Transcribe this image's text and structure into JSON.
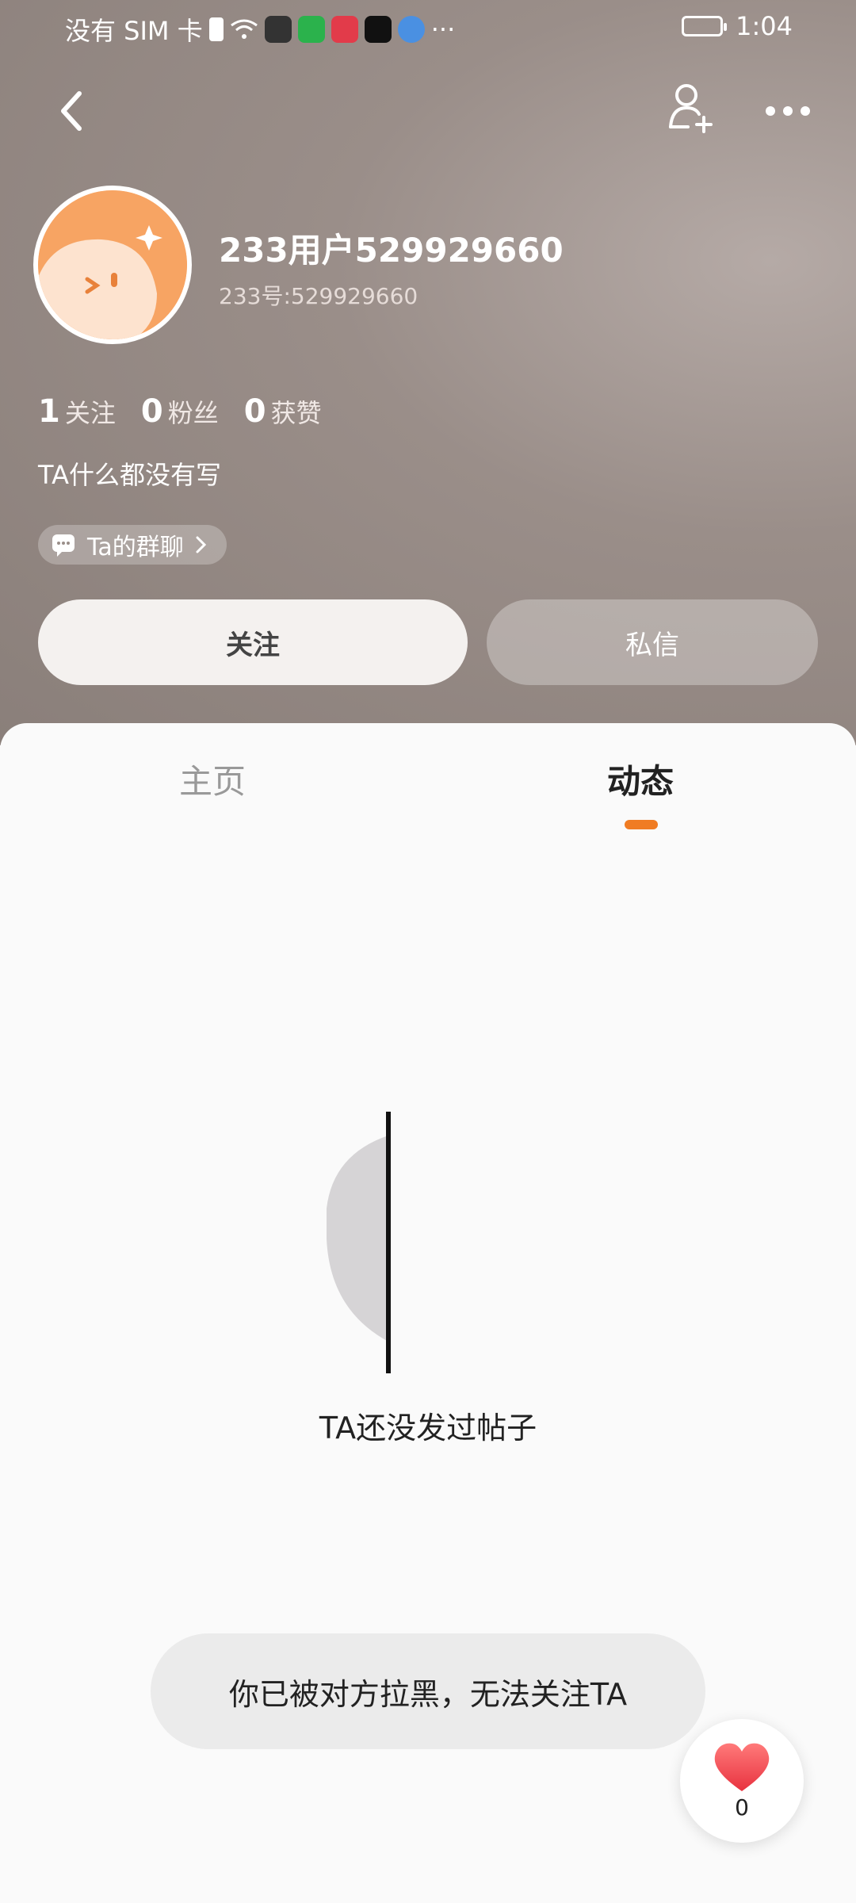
{
  "status_bar": {
    "carrier": "没有 SIM 卡",
    "more": "···",
    "time": "1:04"
  },
  "profile": {
    "username": "233用户529929660",
    "user_id": "233号:529929660",
    "stats": [
      {
        "num": "1",
        "label": "关注"
      },
      {
        "num": "0",
        "label": "粉丝"
      },
      {
        "num": "0",
        "label": "获赞"
      }
    ],
    "bio": "TA什么都没有写",
    "group_chat": "Ta的群聊"
  },
  "actions": {
    "follow": "关注",
    "message": "私信"
  },
  "tabs": [
    {
      "label": "主页",
      "active": false
    },
    {
      "label": "动态",
      "active": true
    }
  ],
  "empty_state": "TA还没发过帖子",
  "toast": "你已被对方拉黑，无法关注TA",
  "like": {
    "count": "0"
  },
  "colors": {
    "accent": "#f07c23",
    "heart": "#f04a5a"
  }
}
